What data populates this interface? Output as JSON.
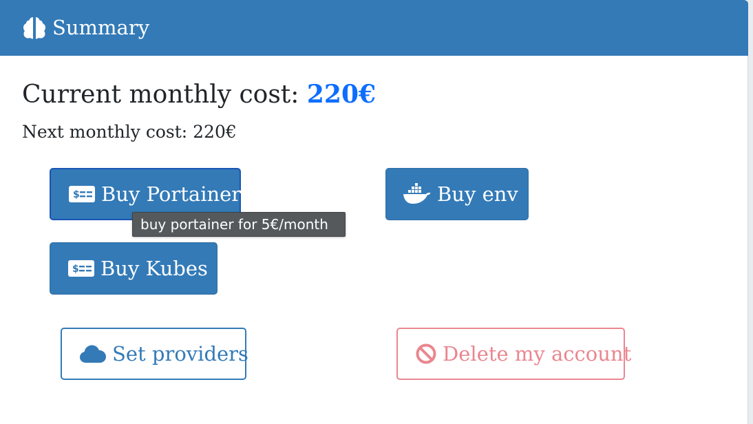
{
  "header": {
    "title": "Summary",
    "icon": "brain-icon"
  },
  "costs": {
    "current_label": "Current monthly cost: ",
    "current_amount": "220€",
    "next_text": "Next monthly cost: 220€"
  },
  "buttons": {
    "buy_portainer": {
      "label": "Buy Portainer",
      "icon": "money-bill-icon"
    },
    "buy_env": {
      "label": "Buy env",
      "icon": "docker-icon"
    },
    "buy_kubes": {
      "label": "Buy Kubes",
      "icon": "money-bill-icon"
    },
    "set_providers": {
      "label": "Set providers",
      "icon": "cloud-icon"
    },
    "delete_account": {
      "label": "Delete my account",
      "icon": "ban-icon"
    }
  },
  "tooltip": {
    "text": "buy portainer for 5€/month"
  },
  "colors": {
    "primary": "#337ab7",
    "amount": "#0d6efd",
    "danger_light": "#ea868f",
    "tooltip_bg": "#55595c"
  }
}
